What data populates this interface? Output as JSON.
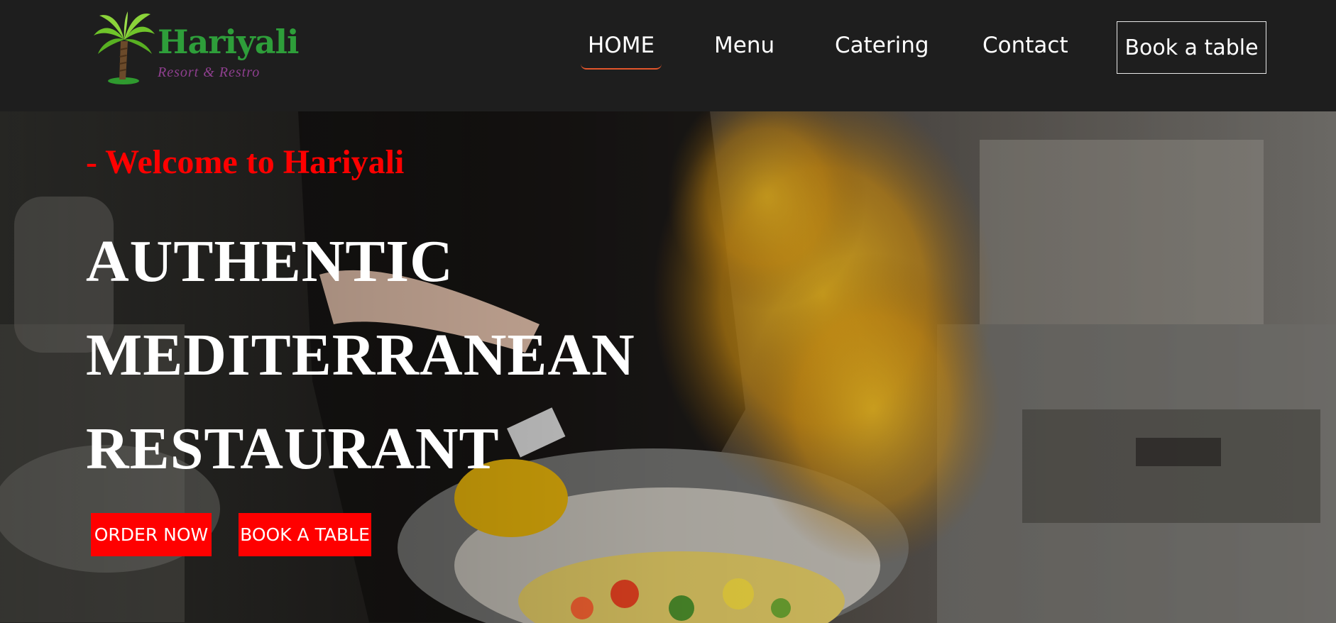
{
  "logo": {
    "title": "Hariyali",
    "subtitle": "Resort & Restro",
    "icon": "palm-tree-icon"
  },
  "nav": {
    "items": [
      {
        "label": "HOME",
        "active": true
      },
      {
        "label": "Menu"
      },
      {
        "label": "Catering"
      },
      {
        "label": "Contact"
      }
    ],
    "book_button": "Book a table"
  },
  "hero": {
    "welcome": "- Welcome to Hariyali",
    "headline": [
      "AUTHENTIC",
      "MEDITERRANEAN",
      "RESTAURANT"
    ],
    "buttons": {
      "order": "ORDER NOW",
      "book": "BOOK A TABLE"
    }
  },
  "colors": {
    "nav_background": "#1e1e1e",
    "accent_red": "#ff0000",
    "active_underline": "#e2552b",
    "logo_green": "#2e9e3a",
    "logo_purple": "#8e3f8e"
  }
}
